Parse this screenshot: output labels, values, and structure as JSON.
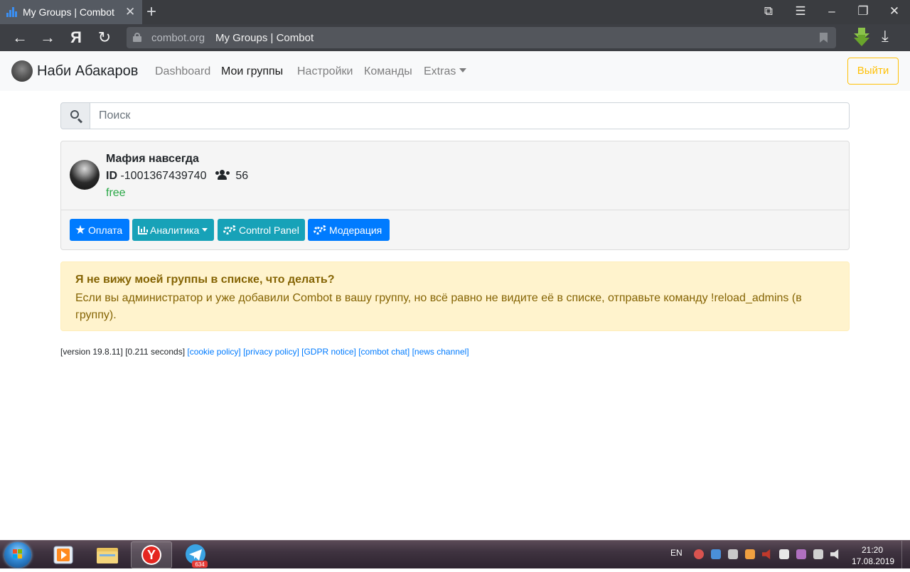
{
  "browser": {
    "tab_title": "My Groups | Combot",
    "close_glyph": "✕",
    "new_tab_glyph": "+",
    "url_domain": "combot.org",
    "url_page_title": "My Groups | Combot",
    "back_glyph": "←",
    "forward_glyph": "→",
    "yandex_glyph": "Я",
    "reload_glyph": "↻",
    "download_glyph": "⤓",
    "win_controls": [
      "⧉",
      "☰",
      "–",
      "❐",
      "✕"
    ]
  },
  "navbar": {
    "user_name": "Наби Абакаров",
    "links": [
      "Dashboard",
      "Мои группы",
      "Настройки",
      "Команды",
      "Extras"
    ],
    "active_index": 1,
    "logout_label": "Выйти"
  },
  "search": {
    "placeholder": "Поиск"
  },
  "group": {
    "name": "Мафия навсегда",
    "id_label": "ID",
    "id_value": "-1001367439740",
    "members": "56",
    "plan": "free",
    "buttons": [
      "Оплата",
      "Аналитика",
      "Control Panel",
      "Модерация"
    ]
  },
  "alert": {
    "heading": "Я не вижу моей группы в списке, что делать?",
    "text": "Если вы администратор и уже добавили Combot в вашу группу, но всё равно не видите её в списке, отправьте команду !reload_admins (в группу)."
  },
  "footer": {
    "version": "[version 19.8.11]",
    "timing": "[0.211 seconds]",
    "links": [
      "[cookie policy]",
      "[privacy policy]",
      "[GDPR notice]",
      "[combot chat]",
      "[news channel]"
    ]
  },
  "taskbar": {
    "lang": "EN",
    "time": "21:20",
    "date": "17.08.2019",
    "telegram_badge": "634",
    "yandex_glyph": "Y"
  },
  "colors": {
    "primary": "#007bff",
    "info": "#17a2b8",
    "warning": "#ffc107",
    "success": "#28a745"
  }
}
